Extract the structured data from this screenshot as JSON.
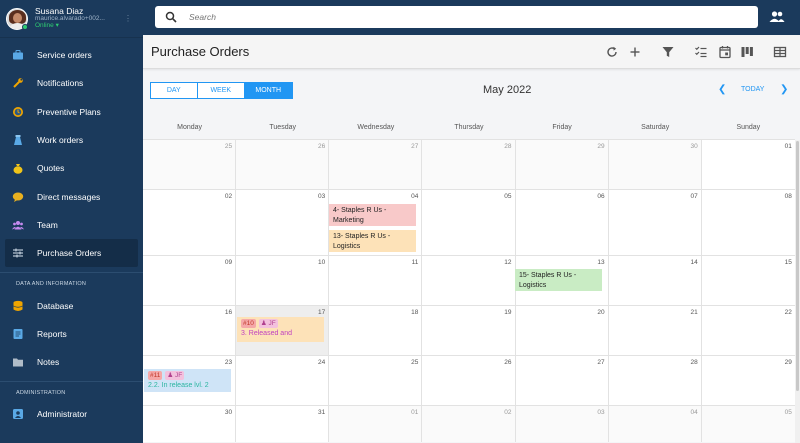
{
  "user": {
    "name": "Susana Diaz",
    "email": "maurice.alvarado+002...",
    "status": "Online ▾"
  },
  "sidebar": {
    "items": [
      {
        "label": "Service orders",
        "icon": "briefcase-icon",
        "color": "#5aa9e6"
      },
      {
        "label": "Notifications",
        "icon": "wrench-icon",
        "color": "#f0a500"
      },
      {
        "label": "Preventive Plans",
        "icon": "clock-icon",
        "color": "#f0a500"
      },
      {
        "label": "Work orders",
        "icon": "stack-icon",
        "color": "#5aa9e6"
      },
      {
        "label": "Quotes",
        "icon": "money-bag-icon",
        "color": "#f0c419"
      },
      {
        "label": "Direct messages",
        "icon": "chat-icon",
        "color": "#e8b020"
      },
      {
        "label": "Team",
        "icon": "team-icon",
        "color": "#c58af0"
      },
      {
        "label": "Purchase Orders",
        "icon": "sliders-icon",
        "color": "#c9d6e3"
      }
    ],
    "data_section": "DATA AND INFORMATION",
    "data_items": [
      {
        "label": "Database",
        "icon": "database-icon",
        "color": "#f0a500"
      },
      {
        "label": "Reports",
        "icon": "report-icon",
        "color": "#5aa9e6"
      },
      {
        "label": "Notes",
        "icon": "folder-icon",
        "color": "#b0bcc8"
      }
    ],
    "admin_section": "ADMINISTRATION",
    "admin_items": [
      {
        "label": "Administrator",
        "icon": "admin-icon",
        "color": "#5aa9e6"
      }
    ]
  },
  "search": {
    "placeholder": "Search"
  },
  "page": {
    "title": "Purchase Orders"
  },
  "calendar": {
    "views": [
      "DAY",
      "WEEK",
      "MONTH"
    ],
    "active_view": "MONTH",
    "month_title": "May 2022",
    "today_label": "TODAY",
    "weekdays": [
      "Monday",
      "Tuesday",
      "Wednesday",
      "Thursday",
      "Friday",
      "Saturday",
      "Sunday"
    ],
    "weeks": [
      [
        {
          "d": "25",
          "o": true
        },
        {
          "d": "26",
          "o": true
        },
        {
          "d": "27",
          "o": true
        },
        {
          "d": "28",
          "o": true
        },
        {
          "d": "29",
          "o": true
        },
        {
          "d": "30",
          "o": true
        },
        {
          "d": "01",
          "o": false
        }
      ],
      [
        {
          "d": "02",
          "o": false
        },
        {
          "d": "03",
          "o": false
        },
        {
          "d": "04",
          "o": false
        },
        {
          "d": "05",
          "o": false
        },
        {
          "d": "06",
          "o": false
        },
        {
          "d": "07",
          "o": false
        },
        {
          "d": "08",
          "o": false
        }
      ],
      [
        {
          "d": "09",
          "o": false
        },
        {
          "d": "10",
          "o": false
        },
        {
          "d": "11",
          "o": false
        },
        {
          "d": "12",
          "o": false
        },
        {
          "d": "13",
          "o": false
        },
        {
          "d": "14",
          "o": false
        },
        {
          "d": "15",
          "o": false
        }
      ],
      [
        {
          "d": "16",
          "o": false
        },
        {
          "d": "17",
          "o": false
        },
        {
          "d": "18",
          "o": false
        },
        {
          "d": "19",
          "o": false
        },
        {
          "d": "20",
          "o": false
        },
        {
          "d": "21",
          "o": false
        },
        {
          "d": "22",
          "o": false
        }
      ],
      [
        {
          "d": "23",
          "o": false
        },
        {
          "d": "24",
          "o": false
        },
        {
          "d": "25",
          "o": false
        },
        {
          "d": "26",
          "o": false
        },
        {
          "d": "27",
          "o": false
        },
        {
          "d": "28",
          "o": false
        },
        {
          "d": "29",
          "o": false
        }
      ],
      [
        {
          "d": "30",
          "o": false
        },
        {
          "d": "31",
          "o": false
        },
        {
          "d": "01",
          "o": true
        },
        {
          "d": "02",
          "o": true
        },
        {
          "d": "03",
          "o": true
        },
        {
          "d": "04",
          "o": true
        },
        {
          "d": "05",
          "o": true
        }
      ]
    ],
    "events": [
      {
        "text": "4- Staples R Us - Marketing",
        "color": "#f8c9c9"
      },
      {
        "text": "13- Staples R Us - Logistics",
        "color": "#fde2b8"
      },
      {
        "text": "15- Staples R Us - Logistics",
        "color": "#c9ecc4"
      },
      {
        "tag1": "#10",
        "tag2": "♟ JF",
        "text": "3. Released and",
        "color": "#fde2b8",
        "text_color": "#c040c0"
      },
      {
        "tag1": "#11",
        "tag2": "♟ JF",
        "text": "2.2. In release lvl. 2",
        "color": "#cfe4f7",
        "text_color": "#2bb5a0"
      }
    ]
  }
}
